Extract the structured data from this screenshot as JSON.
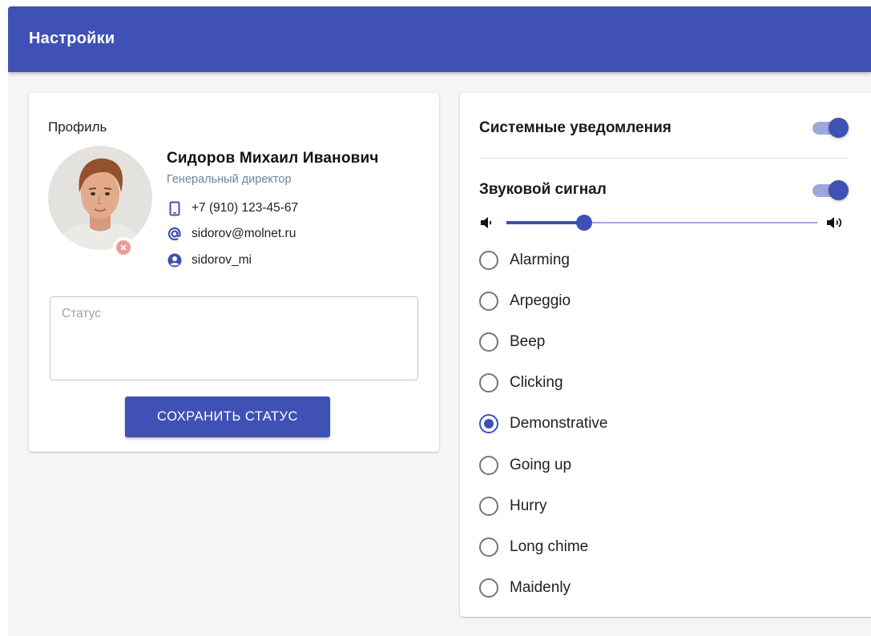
{
  "appbar": {
    "title": "Настройки"
  },
  "profile": {
    "heading": "Профиль",
    "full_name": "Сидоров Михаил Иванович",
    "job_title": "Генеральный директор",
    "phone": "+7 (910) 123-45-67",
    "email": "sidorov@molnet.ru",
    "login": "sidorov_mi",
    "status_value": "",
    "status_placeholder": "Статус",
    "save_button_label": "СОХРАНИТЬ СТАТУС"
  },
  "settings": {
    "system_notifications": {
      "label": "Системные уведомления",
      "enabled": true
    },
    "sound_signal": {
      "label": "Звуковой сигнал",
      "enabled": true
    },
    "volume": {
      "level": 0.25,
      "low_icon": "volume-low-icon",
      "high_icon": "volume-high-icon"
    },
    "sounds": [
      {
        "label": "Alarming",
        "selected": false
      },
      {
        "label": "Arpeggio",
        "selected": false
      },
      {
        "label": "Beep",
        "selected": false
      },
      {
        "label": "Clicking",
        "selected": false
      },
      {
        "label": "Demonstrative",
        "selected": true
      },
      {
        "label": "Going up",
        "selected": false
      },
      {
        "label": "Hurry",
        "selected": false
      },
      {
        "label": "Long chime",
        "selected": false
      },
      {
        "label": "Maidenly",
        "selected": false
      }
    ]
  },
  "colors": {
    "primary": "#3f51b5",
    "primary_light": "#9fa8da",
    "subtitle": "#6c849c",
    "remove_badge": "#ef9a9a"
  }
}
